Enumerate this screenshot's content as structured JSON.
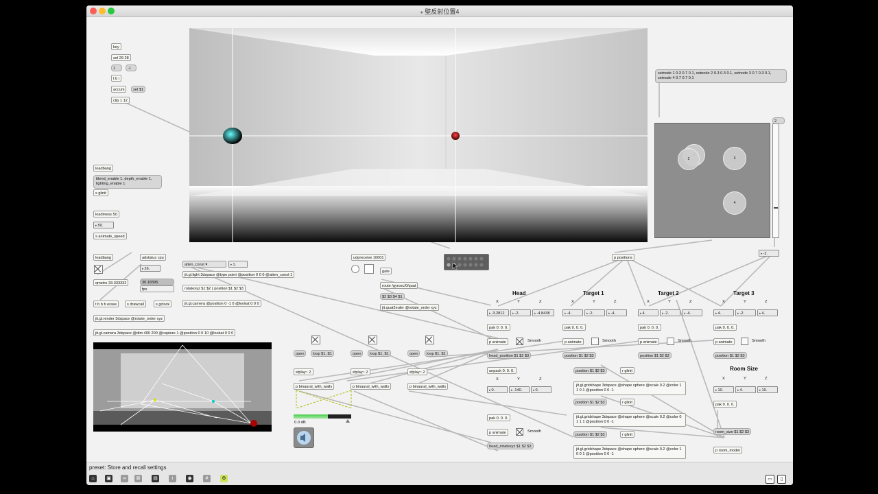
{
  "window": {
    "title": "壁反射位置4"
  },
  "colors": {
    "close": "#fc5f57",
    "minimize": "#fdbc2e",
    "zoom": "#28c840",
    "head_ball": "#19c4c4",
    "target_ball": "#d42020",
    "meter": "#5fd35f"
  },
  "status": {
    "text": "preset: Store and recall settings"
  },
  "labels": {
    "head": "Head",
    "target1": "Target 1",
    "target2": "Target 2",
    "target3": "Target 3",
    "room_size": "Room Size",
    "x": "X",
    "y": "Y",
    "z": "Z",
    "smooth": "Smooth",
    "fps": "fps",
    "db": "0.0 dB"
  },
  "objects": {
    "key": "key",
    "sel": "sel 29 28",
    "msg1": "1",
    "msgm1": "-1",
    "tbi": "t b i",
    "accum": "accum",
    "set1": "set $1",
    "clip": "clip 1 12",
    "loadbang1": "loadbang",
    "blend_msg": "blend_enable 1, depth_enable 1, lighting_enable 1",
    "s_glinit": "s glinit",
    "loadmess": "loadmess 50",
    "num50": "50.",
    "s_anim": "s animate_speed",
    "loadbang2": "loadbang",
    "adstatus": "adstatus cpu",
    "num26": "26.",
    "qmetro": "qmetro 33.333332",
    "fpsval": "30.18395",
    "tbbb": "t b b b erase",
    "s_drawcall": "s drawcall",
    "s_gclock": "s gclock",
    "render": "jit.gl.render 3dspace @rotate_order xyz",
    "camera3d": "jit.gl.camera 3dspace @dim 400 200 @capture 1 @position 0 0 10 @lookat 0 0 0",
    "atten": "atten_const",
    "num1": "1.",
    "light": "jit.gl.light 3dspace @type point @position 0 0 0 @atten_const 1",
    "rotatexyz": "rotatexyz $1 $2 ( position $1 $2 $3",
    "camera2": "jit.gl.camera @position 0 -1 0 @lookat 0 0 0",
    "udp": "udpreceive 10001",
    "gate": "gate",
    "route": "route /gyrosc/0/quat",
    "s2345": "$2 $3 $4 $1",
    "quat2euler": "jit.quat2euler @rotate_order xyz",
    "setnode": "setnode 1 0.3 0.7 0.1, setnode 2 0.3 0.3 0.1, setnode 3 0.7 0.3 0.1, setnode 4 0.7 0.7 0.1",
    "num2": "2",
    "pos": "p positions",
    "numm2": "-2.",
    "open": "open",
    "loop": "loop $1, $1",
    "sfplay": "sfplay~ 2",
    "binaural": "p binaural_with_walls",
    "head_x": "-3.2812",
    "head_y": "-2.",
    "head_z": "-4.8438",
    "pak": "pak 0. 0. 0.",
    "animate": "p animate",
    "head_pos": "head_position $1 $2 $3",
    "t1_x": "-4.",
    "t1_y": "-2.",
    "t1_z": "-4.",
    "t2_x": "4.",
    "t2_y": "-2.",
    "t2_z": "-4.",
    "t3_x": "4.",
    "t3_y": "-2.",
    "t3_z": "4.",
    "pos_msg": "position $1 $2 $3",
    "pos_msg_short": "position $1 $2 $3",
    "r_glinit": "r glinit",
    "unpack": "unpack 0. 0. 0.",
    "rot_x": "0.",
    "rot_y": "-140.",
    "rot_z": "0.",
    "head_rot": "head_rotatexyz $1 $2 $3",
    "grid1": "jit.gl.gridshape 3dspace @shape sphere @scale 0.2 @color 1 1 0 1 @position 0 0 -1",
    "grid2": "jit.gl.gridshape 3dspace @shape sphere @scale 0.2 @color 0 1 1 1 @position 0 0 -1",
    "grid3": "jit.gl.gridshape 3dspace @shape sphere @scale 0.2 @color 1 0 0 1 @position 0 0 -1",
    "room_x": "10.",
    "room_y": "4.",
    "room_z": "10.",
    "room_msg": "room_size $1 $2 $3",
    "room_model": "p room_model"
  },
  "nodes": [
    "1",
    "2",
    "3",
    "4"
  ]
}
